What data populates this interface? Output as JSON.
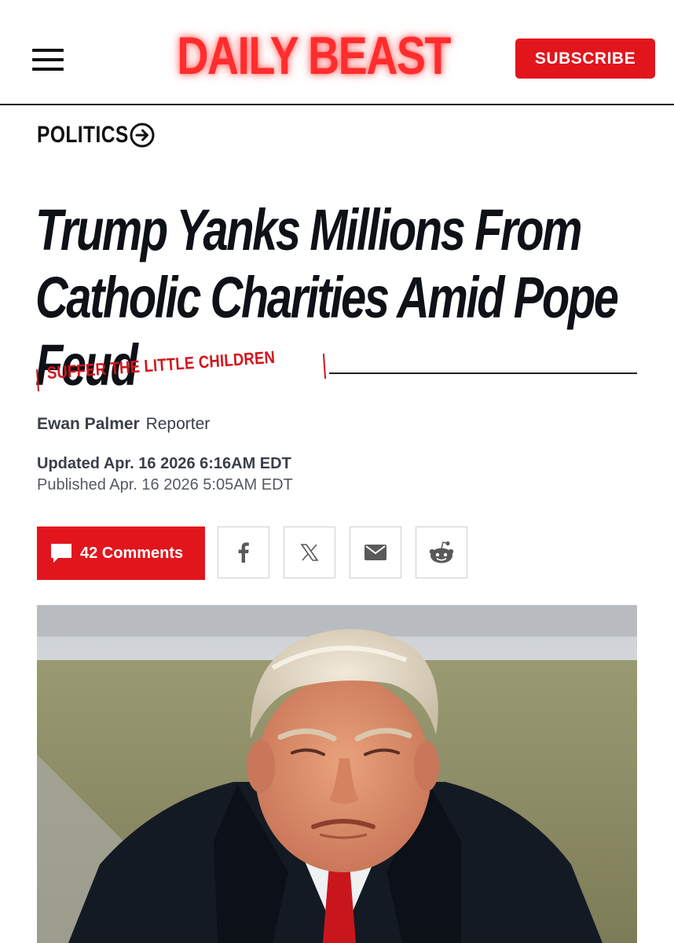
{
  "header": {
    "logo": "DAILY BEAST",
    "subscribe_label": "SUBSCRIBE",
    "brand_color": "#e2151d",
    "menu_icon": "hamburger-menu-icon"
  },
  "article": {
    "section": "POLITICS",
    "section_icon": "arrow-right-circle-icon",
    "headline": "Trump Yanks Millions From Catholic Charities Amid Pope Feud",
    "kicker": "SUFFER THE LITTLE CHILDREN",
    "author": "Ewan Palmer",
    "author_role": "Reporter",
    "updated": "Updated Apr. 16 2026 6:16AM EDT",
    "published": "Published Apr. 16 2026 5:05AM EDT"
  },
  "actions": {
    "comments_label": "42 Comments",
    "comments_icon": "speech-bubble-icon",
    "share_buttons": [
      {
        "name": "facebook",
        "icon": "facebook-icon"
      },
      {
        "name": "x",
        "icon": "x-icon"
      },
      {
        "name": "email",
        "icon": "mail-icon"
      },
      {
        "name": "reddit",
        "icon": "reddit-icon"
      }
    ]
  }
}
